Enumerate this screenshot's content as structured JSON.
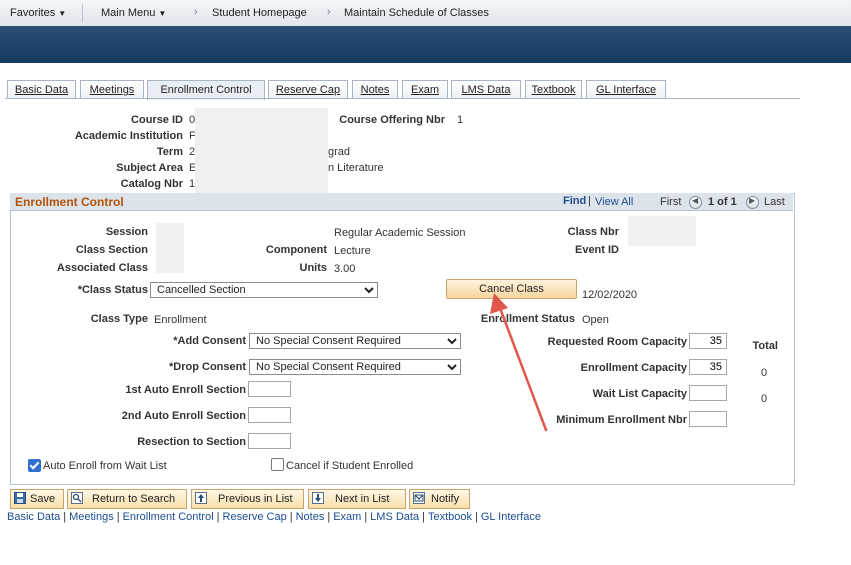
{
  "topnav": {
    "favorites": "Favorites",
    "main_menu": "Main Menu",
    "crumb1": "Student Homepage",
    "crumb2": "Maintain Schedule of Classes"
  },
  "tabs": [
    {
      "label": "Basic Data"
    },
    {
      "label": "Meetings"
    },
    {
      "label": "Enrollment Control"
    },
    {
      "label": "Reserve Cap"
    },
    {
      "label": "Notes"
    },
    {
      "label": "Exam"
    },
    {
      "label": "LMS Data"
    },
    {
      "label": "Textbook"
    },
    {
      "label": "GL Interface"
    }
  ],
  "header": {
    "course_id_label": "Course ID",
    "course_id_value": "0",
    "course_offering_label": "Course Offering Nbr",
    "course_offering_value": "1",
    "institution_label": "Academic Institution",
    "institution_value": "F",
    "term_label": "Term",
    "term_value": "2",
    "term_suffix": "grad",
    "subject_label": "Subject Area",
    "subject_value": "E",
    "subject_suffix": "n Literature",
    "catalog_label": "Catalog Nbr",
    "catalog_value": "1"
  },
  "group": {
    "title": "Enrollment Control",
    "find": "Find",
    "view_all": "View All",
    "first": "First",
    "count": "1 of 1",
    "last": "Last"
  },
  "fields": {
    "session_label": "Session",
    "session_value": "Regular Academic Session",
    "class_nbr_label": "Class Nbr",
    "class_section_label": "Class Section",
    "component_label": "Component",
    "component_value": "Lecture",
    "event_id_label": "Event ID",
    "assoc_class_label": "Associated Class",
    "units_label": "Units",
    "units_value": "3.00",
    "class_status_label": "*Class Status",
    "class_status_value": "Cancelled Section",
    "cancel_button": "Cancel Class",
    "cancel_date": "12/02/2020",
    "class_type_label": "Class Type",
    "class_type_value": "Enrollment",
    "enroll_status_label": "Enrollment Status",
    "enroll_status_value": "Open",
    "add_consent_label": "*Add Consent",
    "add_consent_value": "No Special Consent Required",
    "drop_consent_label": "*Drop Consent",
    "drop_consent_value": "No Special Consent Required",
    "auto1_label": "1st Auto Enroll Section",
    "auto2_label": "2nd Auto Enroll Section",
    "resection_label": "Resection to Section",
    "req_room_label": "Requested Room Capacity",
    "req_room_value": "35",
    "enroll_cap_label": "Enrollment Capacity",
    "enroll_cap_value": "35",
    "waitlist_label": "Wait List Capacity",
    "min_enroll_label": "Minimum Enrollment Nbr",
    "total_label": "Total",
    "total_enroll": "0",
    "total_wait": "0",
    "auto_enroll_wait_label": "Auto Enroll from Wait List",
    "auto_enroll_wait_checked": true,
    "cancel_if_label": "Cancel if Student Enrolled",
    "cancel_if_checked": false
  },
  "toolbar": {
    "save": "Save",
    "return": "Return to Search",
    "previous": "Previous in List",
    "next": "Next in List",
    "notify": "Notify"
  },
  "bottom_links": [
    "Basic Data",
    "Meetings",
    "Enrollment Control",
    "Reserve Cap",
    "Notes",
    "Exam",
    "LMS Data",
    "Textbook",
    "GL Interface"
  ],
  "colors": {
    "banner": "#163a60",
    "section_title": "#b4520a",
    "link": "#1d4d8f",
    "annotation_arrow": "#e2574c"
  }
}
